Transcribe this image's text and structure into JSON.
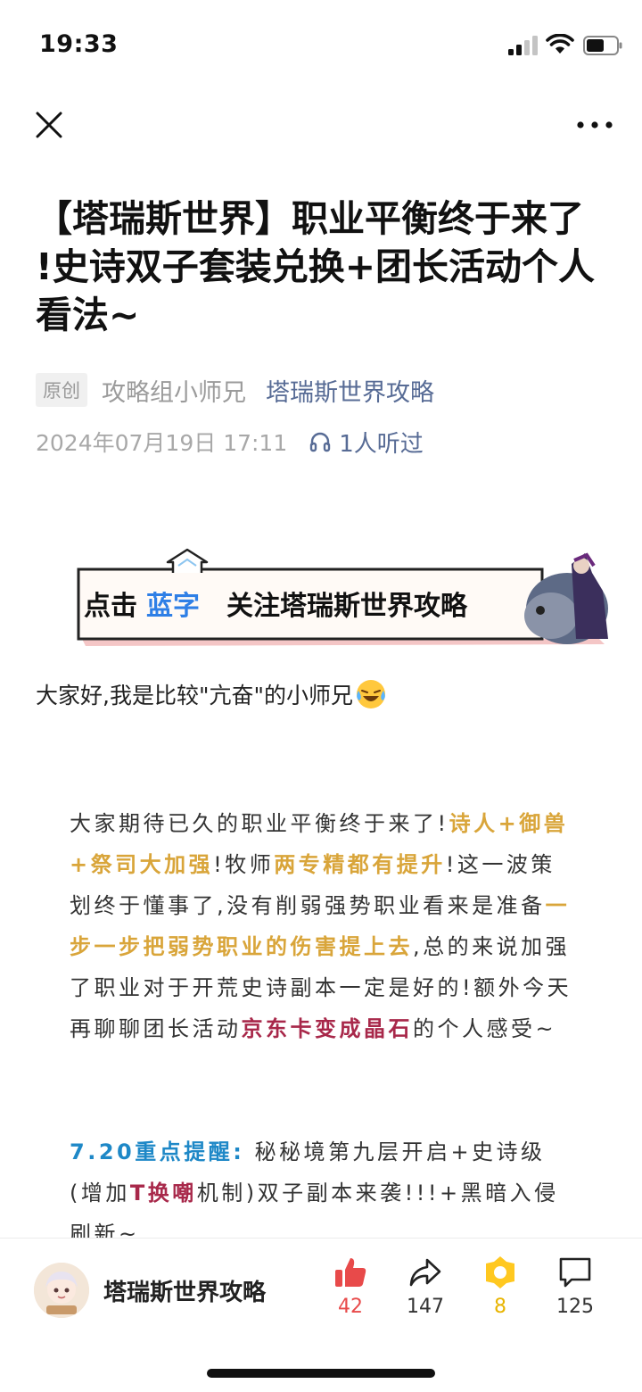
{
  "status_bar": {
    "time": "19:33"
  },
  "nav": {
    "close_icon": "close-icon",
    "more_icon": "more-icon"
  },
  "article": {
    "title": "【塔瑞斯世界】职业平衡终于来了 !史诗双子套装兑换+团长活动个人看法~",
    "badge": "原创",
    "author": "攻略组小师兄",
    "account": "塔瑞斯世界攻略",
    "date": "2024年07月19日 17:11",
    "listen_text": "1人听过",
    "banner": {
      "click": "点击",
      "blue_word": "蓝字",
      "follow": "关注塔瑞斯世界攻略"
    },
    "greeting": "大家好,我是比较\"亢奋\"的小师兄",
    "para1": [
      {
        "text": "大家期待已久的职业平衡终于来了!",
        "style": "normal"
      },
      {
        "text": "诗人+御兽+祭司大加强",
        "style": "gold"
      },
      {
        "text": "!牧师",
        "style": "normal"
      },
      {
        "text": "两专精都有提升",
        "style": "gold"
      },
      {
        "text": "!这一波策划终于懂事了,没有削弱强势职业看来是准备",
        "style": "normal"
      },
      {
        "text": "一步一步把弱势职业的伤害提上去",
        "style": "gold"
      },
      {
        "text": ",总的来说加强了职业对于开荒史诗副本一定是好的!额外今天再聊聊团长活动",
        "style": "normal"
      },
      {
        "text": "京东卡变成晶石",
        "style": "crimson"
      },
      {
        "text": "的个人感受~",
        "style": "normal"
      }
    ],
    "para2": [
      {
        "text": "7.20重点提醒:",
        "style": "blue"
      },
      {
        "text": " 秘秘境第九层开启+史诗级(增加",
        "style": "normal"
      },
      {
        "text": "T换嘲",
        "style": "crimson"
      },
      {
        "text": "机制)双子副本来袭!!!+黑暗入侵刷新~",
        "style": "normal"
      }
    ]
  },
  "bottom_bar": {
    "account_name": "塔瑞斯世界攻略",
    "likes": "42",
    "shares": "147",
    "wows": "8",
    "comments": "125"
  },
  "colors": {
    "link": "#576b95",
    "gold": "#d9a53a",
    "crimson": "#a8284a",
    "blue": "#1e88c7",
    "like": "#e84a4a",
    "wow": "#e8b400"
  }
}
